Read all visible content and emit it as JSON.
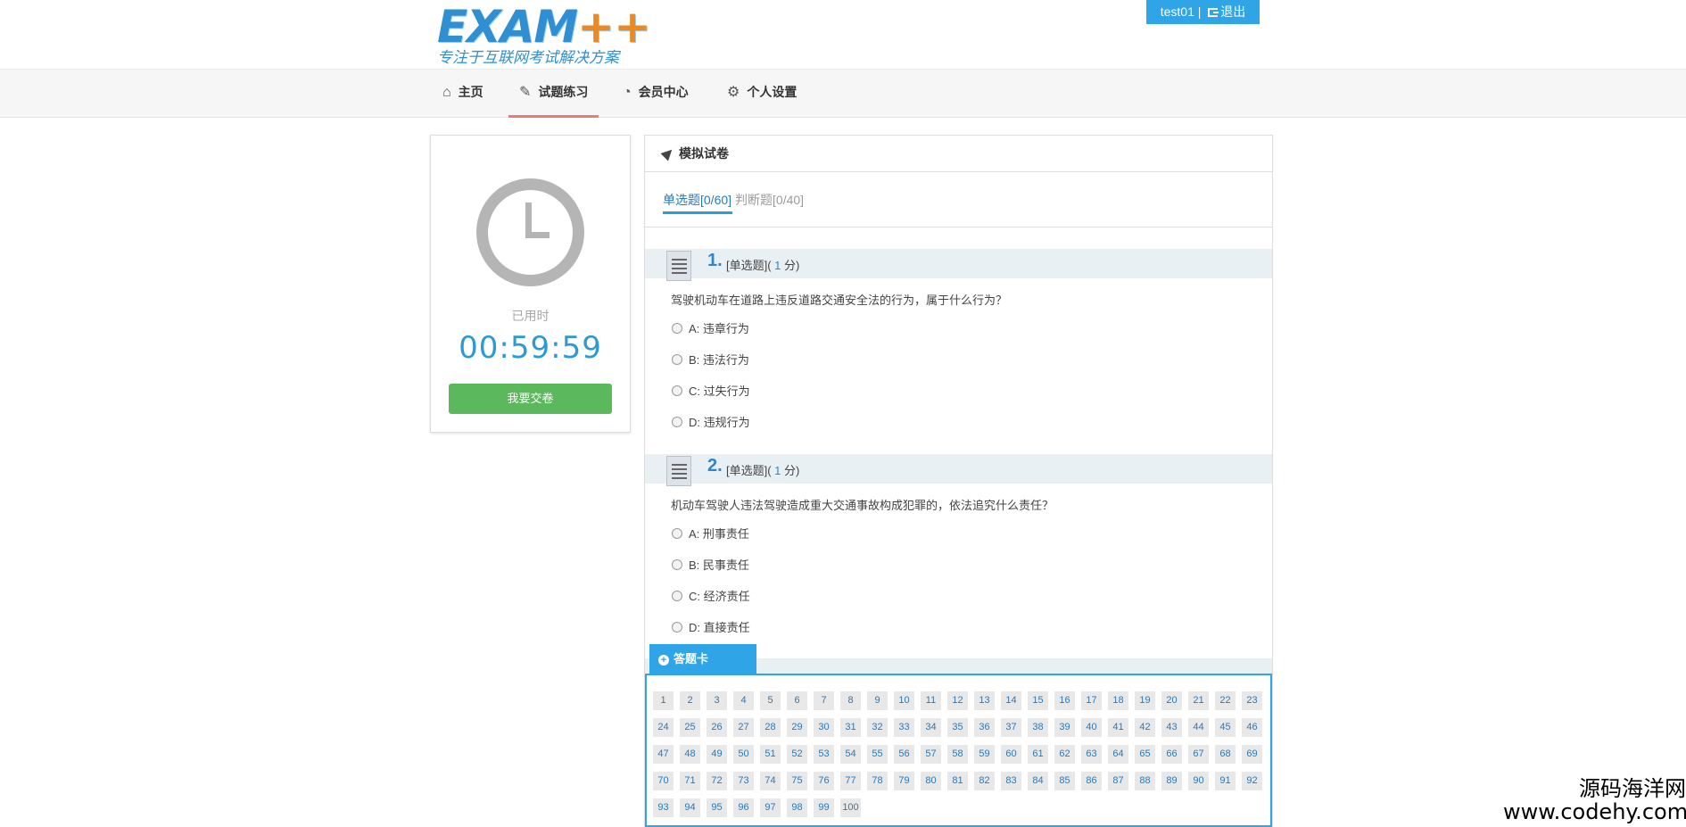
{
  "header": {
    "logo_text": "EXAM",
    "logo_plus": "++",
    "slogan": "专注于互联网考试解决方案",
    "username": "test01",
    "separator": "|",
    "logout": "退出"
  },
  "nav": {
    "items": [
      {
        "label": "主页",
        "icon": "home-icon"
      },
      {
        "label": "试题练习",
        "icon": "edit-icon",
        "active": true
      },
      {
        "label": "会员中心",
        "icon": "dashboard-icon"
      },
      {
        "label": "个人设置",
        "icon": "gears-icon"
      }
    ]
  },
  "timer": {
    "label": "已用时",
    "time": "00:59:59",
    "submit": "我要交卷"
  },
  "exam": {
    "title": "模拟试卷",
    "tabs": [
      "单选题[0/60]",
      "判断题[0/40]"
    ],
    "questions": [
      {
        "num": "1.",
        "type_prefix": "[单选题](",
        "score": " 1 ",
        "type_suffix": "分)",
        "text": "驾驶机动车在道路上违反道路交通安全法的行为，属于什么行为？",
        "options": [
          "A: 违章行为",
          "B: 违法行为",
          "C: 过失行为",
          "D: 违规行为"
        ]
      },
      {
        "num": "2.",
        "type_prefix": "[单选题](",
        "score": " 1 ",
        "type_suffix": "分)",
        "text": "机动车驾驶人违法驾驶造成重大交通事故构成犯罪的，依法追究什么责任？",
        "options": [
          "A: 刑事责任",
          "B: 民事责任",
          "C: 经济责任",
          "D: 直接责任"
        ]
      }
    ]
  },
  "answer_card": {
    "label": "答题卡",
    "count": 100
  },
  "watermark": {
    "cn": "源码海洋网",
    "en": "www.codehy.com"
  },
  "colors": {
    "accent": "#2fa4e7",
    "success": "#5cb85c",
    "nav_active": "#e57e73",
    "question_blue": "#2e86c8"
  }
}
